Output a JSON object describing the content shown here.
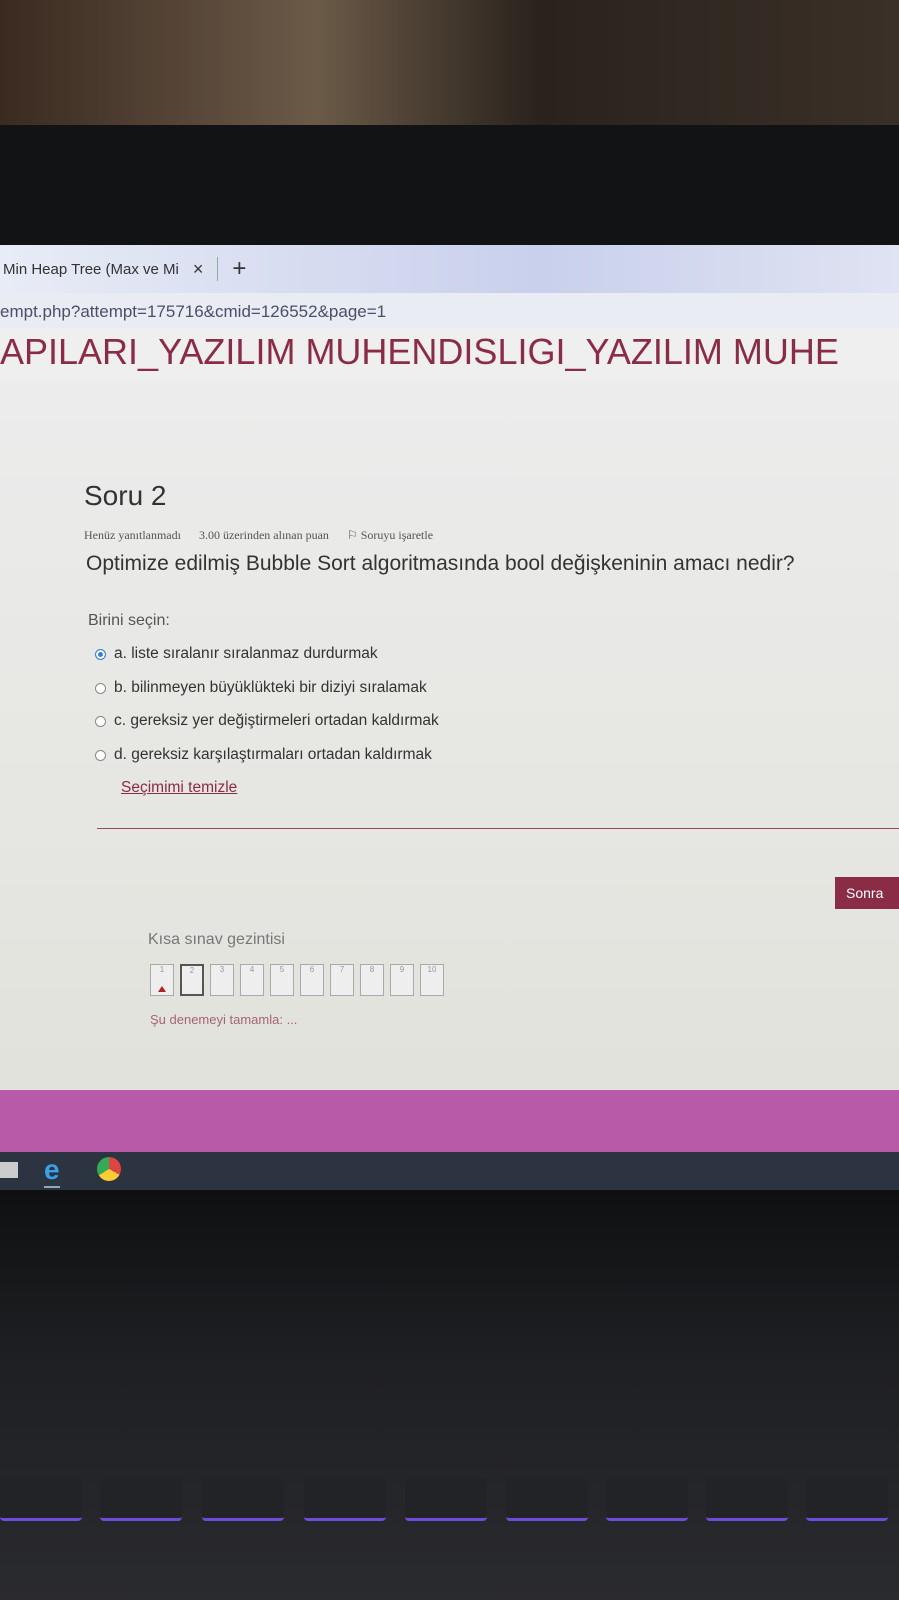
{
  "browser": {
    "tab_title": "Min Heap Tree (Max ve Mi",
    "tab_close": "×",
    "new_tab": "+",
    "url": "empt.php?attempt=175716&cmid=126552&page=1"
  },
  "banner": {
    "title": "APILARI_YAZILIM MUHENDISLIGI_YAZILIM MUHE"
  },
  "question": {
    "heading": "Soru 2",
    "status": "Henüz yanıtlanmadı",
    "points": "3.00 üzerinden alınan puan",
    "flag_label": "Soruyu işaretle",
    "text": "Optimize edilmiş Bubble Sort algoritmasında bool değişkeninin amacı nedir?",
    "choose_label": "Birini seçin:",
    "options": [
      {
        "label": "a. liste sıralanır sıralanmaz durdurmak",
        "selected": true
      },
      {
        "label": "b. bilinmeyen büyüklükteki bir diziyi sıralamak",
        "selected": false
      },
      {
        "label": "c. gereksiz yer değiştirmeleri ortadan kaldırmak",
        "selected": false
      },
      {
        "label": "d. gereksiz karşılaştırmaları ortadan kaldırmak",
        "selected": false
      }
    ],
    "clear_label": "Seçimimi temizle"
  },
  "next_button": "Sonra",
  "quiz_nav": {
    "title": "Kısa sınav gezintisi",
    "buttons": [
      "1",
      "2",
      "3",
      "4",
      "5",
      "6",
      "7",
      "8",
      "9",
      "10"
    ],
    "current": "2",
    "flagged": "1",
    "finish_label": "Şu denemeyi tamamla: ..."
  },
  "colors": {
    "brand": "#8a2c45",
    "footer": "#b75aa8"
  }
}
